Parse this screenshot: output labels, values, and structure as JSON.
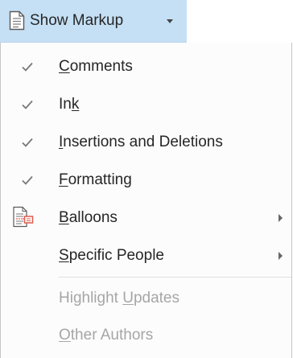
{
  "button": {
    "label": "Show Markup",
    "icon": "document-icon",
    "accent": "#c5e0f5"
  },
  "menu": {
    "items": [
      {
        "pre": "",
        "key": "C",
        "post": "omments",
        "checked": true,
        "enabled": true,
        "submenu": false
      },
      {
        "pre": "In",
        "key": "k",
        "post": "",
        "checked": true,
        "enabled": true,
        "submenu": false
      },
      {
        "pre": "",
        "key": "I",
        "post": "nsertions and Deletions",
        "checked": true,
        "enabled": true,
        "submenu": false
      },
      {
        "pre": "",
        "key": "F",
        "post": "ormatting",
        "checked": true,
        "enabled": true,
        "submenu": false
      },
      {
        "pre": "",
        "key": "B",
        "post": "alloons",
        "checked": false,
        "enabled": true,
        "submenu": true,
        "icon": "balloons-icon"
      },
      {
        "pre": "",
        "key": "S",
        "post": "pecific People",
        "checked": false,
        "enabled": true,
        "submenu": true
      },
      {
        "pre": "Highlight ",
        "key": "U",
        "post": "pdates",
        "checked": false,
        "enabled": false,
        "submenu": false
      },
      {
        "pre": "",
        "key": "O",
        "post": "ther Authors",
        "checked": false,
        "enabled": false,
        "submenu": false
      }
    ]
  },
  "colors": {
    "text": "#262626",
    "disabled_text": "#a6a6a6",
    "check": "#777777",
    "balloon_red": "#e05a4e"
  }
}
